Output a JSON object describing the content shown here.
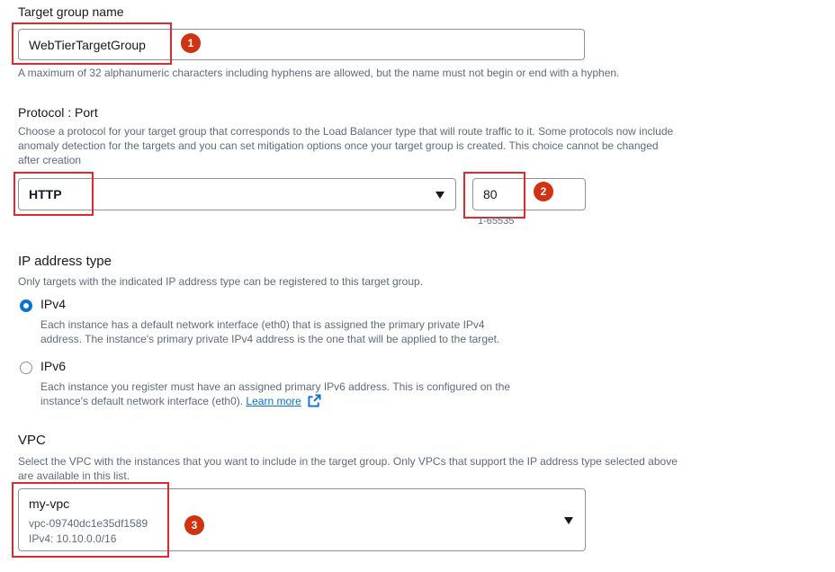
{
  "target_group_name": {
    "label": "Target group name",
    "value": "WebTierTargetGroup",
    "hint": "A maximum of 32 alphanumeric characters including hyphens are allowed, but the name must not begin or end with a hyphen.",
    "step_badge": "1"
  },
  "protocol_port": {
    "label": "Protocol : Port",
    "description_line1": "Choose a protocol for your target group that corresponds to the Load Balancer type that will route traffic to it. Some protocols now include",
    "description_line2": "anomaly detection for the targets and you can set mitigation options once your target group is created. This choice cannot be changed",
    "description_line3": "after creation",
    "protocol_value": "HTTP",
    "port_value": "80",
    "port_hint": "1-65535",
    "step_badge": "2"
  },
  "ip_address_type": {
    "label": "IP address type",
    "description": "Only targets with the indicated IP address type can be registered to this target group.",
    "options": [
      {
        "label": "IPv4",
        "selected": true,
        "desc_line1": "Each instance has a default network interface (eth0) that is assigned the primary private IPv4",
        "desc_line2": "address. The instance's primary private IPv4 address is the one that will be applied to the target."
      },
      {
        "label": "IPv6",
        "selected": false,
        "desc_line1": "Each instance you register must have an assigned primary IPv6 address. This is configured on the",
        "desc_line2": "instance's default network interface (eth0).",
        "link_text": "Learn more"
      }
    ]
  },
  "vpc": {
    "label": "VPC",
    "description_line1": "Select the VPC with the instances that you want to include in the target group. Only VPCs that support the IP address type selected above",
    "description_line2": "are available in this list.",
    "selected_name": "my-vpc",
    "selected_id": "vpc-09740dc1e35df1589",
    "selected_cidr": "IPv4: 10.10.0.0/16",
    "step_badge": "3"
  },
  "colors": {
    "accent": "#0972d3",
    "highlight": "#e0292f",
    "badge": "#d13212"
  },
  "icons": [
    "caret-down-icon",
    "external-link-icon",
    "radio-selected-icon",
    "radio-unselected-icon"
  ]
}
